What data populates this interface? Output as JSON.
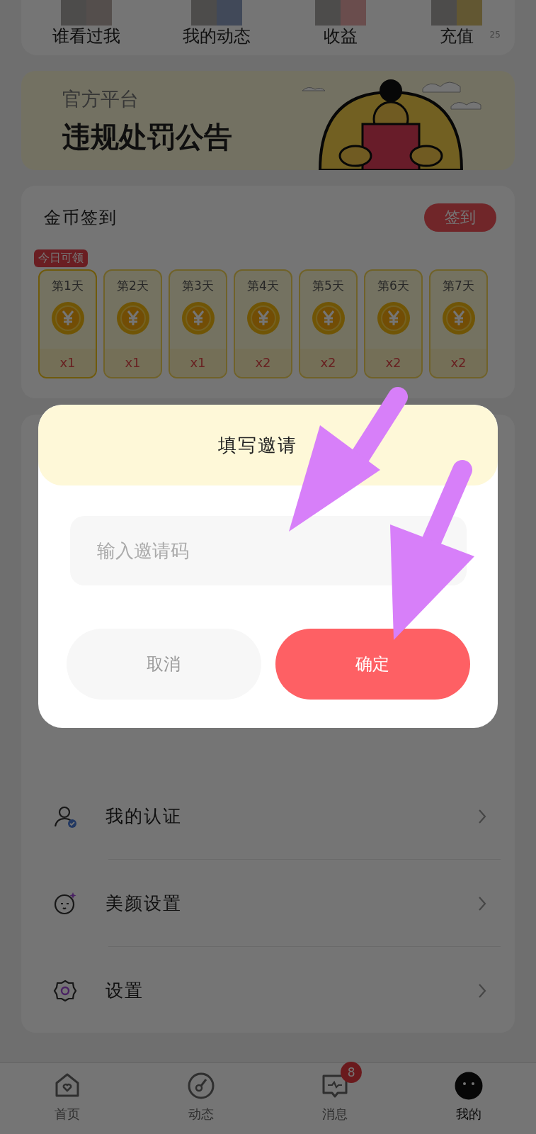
{
  "top_shortcuts": [
    {
      "label": "谁看过我"
    },
    {
      "label": "我的动态"
    },
    {
      "label": "收益"
    },
    {
      "label": "充值",
      "count": "25"
    }
  ],
  "banner": {
    "subtitle": "官方平台",
    "title": "违规处罚公告",
    "kind": "picture"
  },
  "sign_in": {
    "title": "金币签到",
    "button": "签到",
    "today_tag": "今日可领",
    "days": [
      {
        "label": "第1天",
        "reward": "x1",
        "today": true
      },
      {
        "label": "第2天",
        "reward": "x1",
        "today": false
      },
      {
        "label": "第3天",
        "reward": "x1",
        "today": false
      },
      {
        "label": "第4天",
        "reward": "x2",
        "today": false
      },
      {
        "label": "第5天",
        "reward": "x2",
        "today": false
      },
      {
        "label": "第6天",
        "reward": "x2",
        "today": false
      },
      {
        "label": "第7天",
        "reward": "x2",
        "today": false
      }
    ]
  },
  "menu": [
    {
      "label": "我的认证",
      "kind": "verify"
    },
    {
      "label": "美颜设置",
      "kind": "beauty"
    },
    {
      "label": "设置",
      "kind": "settings"
    }
  ],
  "dialog": {
    "title": "填写邀请",
    "placeholder": "输入邀请码",
    "cancel": "取消",
    "confirm": "确定"
  },
  "bottom_nav": [
    {
      "label": "首页",
      "kind": "home",
      "selected": false
    },
    {
      "label": "动态",
      "kind": "dial",
      "selected": false
    },
    {
      "label": "消息",
      "kind": "message",
      "selected": false,
      "badge": "8"
    },
    {
      "label": "我的",
      "kind": "profile",
      "selected": true
    }
  ]
}
